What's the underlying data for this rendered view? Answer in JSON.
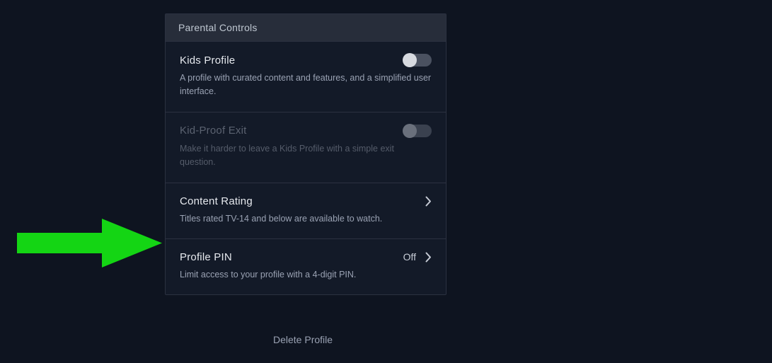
{
  "panel": {
    "header": "Parental Controls",
    "kids_profile": {
      "title": "Kids Profile",
      "description": "A profile with curated content and features, and a simplified user interface."
    },
    "kid_proof_exit": {
      "title": "Kid-Proof Exit",
      "description": "Make it harder to leave a Kids Profile with a simple exit question."
    },
    "content_rating": {
      "title": "Content Rating",
      "description": "Titles rated TV-14 and below are available to watch."
    },
    "profile_pin": {
      "title": "Profile PIN",
      "status": "Off",
      "description": "Limit access to your profile with a 4-digit PIN."
    }
  },
  "delete_profile_label": "Delete Profile"
}
